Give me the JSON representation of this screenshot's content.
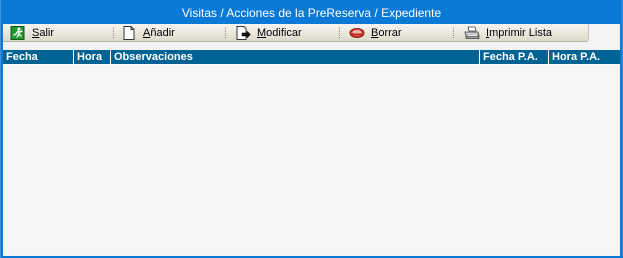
{
  "window": {
    "title": "Visitas / Acciones de la PreReserva / Expediente"
  },
  "toolbar": {
    "buttons": [
      {
        "label": "Salir",
        "icon": "exit-icon"
      },
      {
        "label": "Añadir",
        "icon": "new-document-icon"
      },
      {
        "label": "Modificar",
        "icon": "edit-document-icon"
      },
      {
        "label": "Borrar",
        "icon": "delete-icon"
      },
      {
        "label": "Imprimir Lista",
        "icon": "printer-icon"
      }
    ]
  },
  "grid": {
    "columns": [
      "Fecha",
      "Hora",
      "Observaciones",
      "Fecha P.A.",
      "Hora P.A."
    ],
    "rows": []
  },
  "colors": {
    "title_bar": "#0b79d6",
    "grid_header": "#006393",
    "toolbar": "#eceae0",
    "grid_background": "#f6f6f6"
  }
}
